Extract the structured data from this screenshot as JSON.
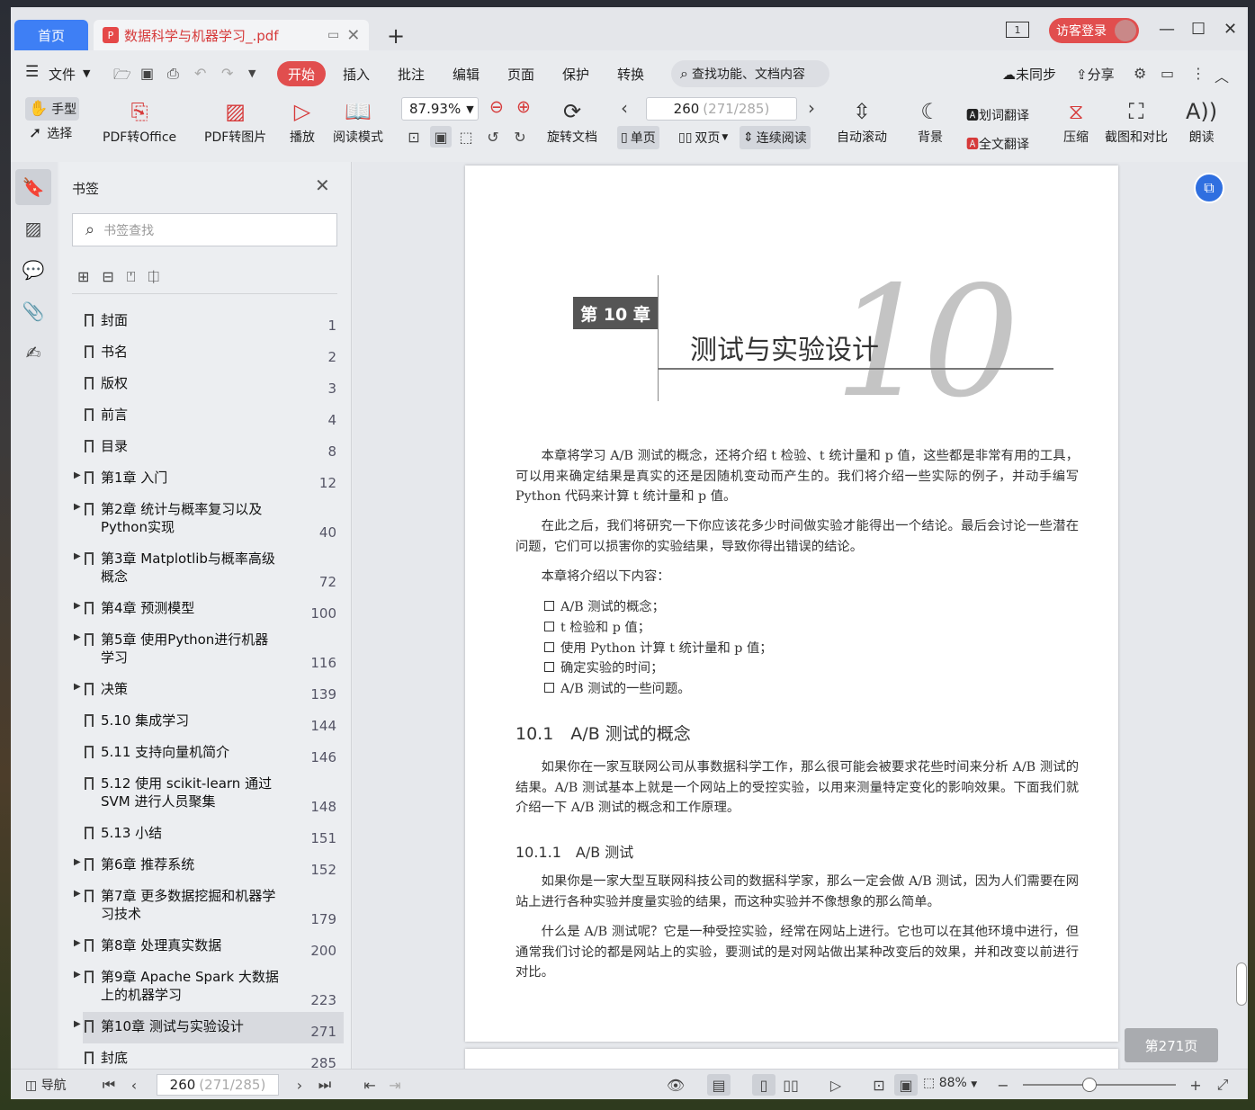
{
  "titlebar": {
    "home_tab": "首页",
    "doc_tab": "数据科学与机器学习_.pdf",
    "doc_badge": "P",
    "new_tab": "+",
    "tab_count": "1",
    "login": "访客登录"
  },
  "menu": {
    "file": "文件",
    "items": [
      "开始",
      "插入",
      "批注",
      "编辑",
      "页面",
      "保护",
      "转换"
    ],
    "search_placeholder": "查找功能、文档内容",
    "sync": "未同步",
    "share": "分享"
  },
  "toolbar": {
    "hand": "手型",
    "select": "选择",
    "pdf_to_office": "PDF转Office",
    "pdf_to_image": "PDF转图片",
    "play": "播放",
    "read_mode": "阅读模式",
    "zoom": "87.93%",
    "page_current": "260",
    "page_total": "(271/285)",
    "rotate_doc": "旋转文档",
    "single": "单页",
    "double": "双页",
    "continuous": "连续阅读",
    "auto_scroll": "自动滚动",
    "background": "背景",
    "word_translate": "划词翻译",
    "full_translate": "全文翻译",
    "compress": "压缩",
    "screenshot_compare": "截图和对比",
    "read_aloud": "朗读"
  },
  "bookmarks": {
    "title": "书签",
    "search_placeholder": "书签查找",
    "items": [
      {
        "label": "封面",
        "page": "1",
        "expandable": false
      },
      {
        "label": "书名",
        "page": "2",
        "expandable": false
      },
      {
        "label": "版权",
        "page": "3",
        "expandable": false
      },
      {
        "label": "前言",
        "page": "4",
        "expandable": false
      },
      {
        "label": "目录",
        "page": "8",
        "expandable": false
      },
      {
        "label": "第1章 入门",
        "page": "12",
        "expandable": true
      },
      {
        "label": "第2章 统计与概率复习以及Python实现",
        "page": "40",
        "expandable": true
      },
      {
        "label": "第3章 Matplotlib与概率高级概念",
        "page": "72",
        "expandable": true
      },
      {
        "label": "第4章 预测模型",
        "page": "100",
        "expandable": true
      },
      {
        "label": "第5章 使用Python进行机器学习",
        "page": "116",
        "expandable": true
      },
      {
        "label": "决策",
        "page": "139",
        "expandable": true
      },
      {
        "label": "5.10 集成学习",
        "page": "144",
        "expandable": false
      },
      {
        "label": "5.11 支持向量机简介",
        "page": "146",
        "expandable": false
      },
      {
        "label": "5.12 使用 scikit-learn 通过 SVM 进行人员聚集",
        "page": "148",
        "expandable": false
      },
      {
        "label": "5.13 小结",
        "page": "151",
        "expandable": false
      },
      {
        "label": "第6章 推荐系统",
        "page": "152",
        "expandable": true
      },
      {
        "label": "第7章 更多数据挖掘和机器学习技术",
        "page": "179",
        "expandable": true
      },
      {
        "label": "第8章 处理真实数据",
        "page": "200",
        "expandable": true
      },
      {
        "label": "第9章 Apache Spark 大数据上的机器学习",
        "page": "223",
        "expandable": true
      },
      {
        "label": "第10章 测试与实验设计",
        "page": "271",
        "expandable": true
      },
      {
        "label": "封底",
        "page": "285",
        "expandable": false
      }
    ]
  },
  "document": {
    "chapter_badge": "第 10 章",
    "chapter_number": "10",
    "chapter_title": "测试与实验设计",
    "intro1": "本章将学习 A/B 测试的概念，还将介绍 t 检验、t 统计量和 p 值，这些都是非常有用的工具，可以用来确定结果是真实的还是因随机变动而产生的。我们将介绍一些实际的例子，并动手编写 Python 代码来计算 t 统计量和 p 值。",
    "intro2": "在此之后，我们将研究一下你应该花多少时间做实验才能得出一个结论。最后会讨论一些潜在问题，它们可以损害你的实验结果，导致你得出错误的结论。",
    "intro3": "本章将介绍以下内容：",
    "list": [
      "A/B 测试的概念；",
      "t 检验和 p 值；",
      "使用 Python 计算 t 统计量和 p 值；",
      "确定实验的时间；",
      "A/B 测试的一些问题。"
    ],
    "h2": "10.1　A/B 测试的概念",
    "para_10_1": "如果你在一家互联网公司从事数据科学工作，那么很可能会被要求花些时间来分析 A/B 测试的结果。A/B 测试基本上就是一个网站上的受控实验，以用来测量特定变化的影响效果。下面我们就介绍一下 A/B 测试的概念和工作原理。",
    "h3": "10.1.1　A/B 测试",
    "para_a": "如果你是一家大型互联网科技公司的数据科学家，那么一定会做 A/B 测试，因为人们需要在网站上进行各种实验并度量实验的结果，而这种实验并不像想象的那么简单。",
    "para_b": "什么是 A/B 测试呢？它是一种受控实验，经常在网站上进行。它也可以在其他环境中进行，但通常我们讨论的都是网站上的实验，要测试的是对网站做出某种改变后的效果，并和改变以前进行对比。",
    "page_indicator": "第271页"
  },
  "status": {
    "nav": "导航",
    "page_current": "260",
    "page_total": "(271/285)",
    "zoom": "88%"
  }
}
